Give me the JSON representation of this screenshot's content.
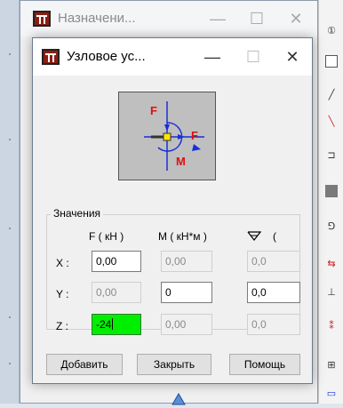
{
  "back_window": {
    "title": "Назначени..."
  },
  "dialog": {
    "title": "Узловое ус...",
    "group_title": "Значения",
    "diagram": {
      "force_label": "F",
      "moment_label": "M"
    },
    "columns": [
      "F ( кН )",
      "M ( кН*м )",
      "("
    ],
    "rows": [
      {
        "label": "X :",
        "f": "0,00",
        "m": "0,00",
        "r": "0,0"
      },
      {
        "label": "Y :",
        "f": "0,00",
        "m": "0",
        "r": "0,0"
      },
      {
        "label": "Z :",
        "f": "-24",
        "m": "0,00",
        "r": "0,0"
      }
    ],
    "buttons": {
      "add": "Добавить",
      "close": "Закрыть",
      "help": "Помощь"
    }
  },
  "right_toolbar": {
    "top_label": "①"
  },
  "colors": {
    "active_field": "#00ee00",
    "arrow_blue": "#1a2fd6",
    "arrow_red": "#e01010"
  }
}
